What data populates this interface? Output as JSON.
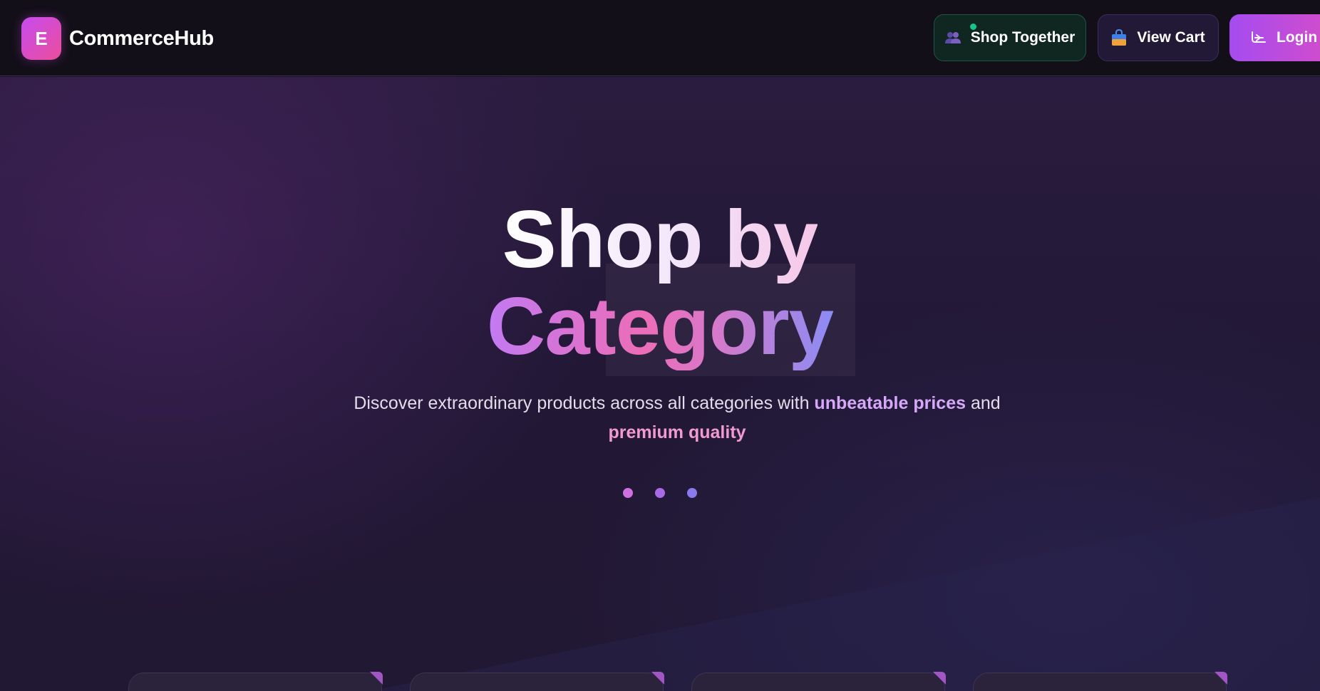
{
  "brand": {
    "logo_letter": "E",
    "name": "CommerceHub"
  },
  "nav": {
    "shop_together": {
      "label": "Shop Together",
      "icon": "users-icon",
      "online_indicator": true
    },
    "view_cart": {
      "label": "View Cart",
      "icon": "shopping-bag-icon"
    },
    "login": {
      "label": "Login",
      "icon": "login-arrow-icon"
    }
  },
  "hero": {
    "title_line1": "Shop by",
    "title_line2": "Category",
    "subtitle_part1": "Discover extraordinary products across all categories with ",
    "subtitle_highlight1": "unbeatable prices",
    "subtitle_part2": " and",
    "subtitle_highlight2": "premium quality",
    "indicator_dots": 3
  },
  "category_cards_visible": 4,
  "colors": {
    "background": "#14101c",
    "accent_purple": "#c27af2",
    "accent_pink": "#ec6db8",
    "accent_indigo": "#8b8cf4",
    "online_green": "#16c48b",
    "login_gradient_start": "#a54cf0",
    "login_gradient_end": "#d64cc8"
  }
}
